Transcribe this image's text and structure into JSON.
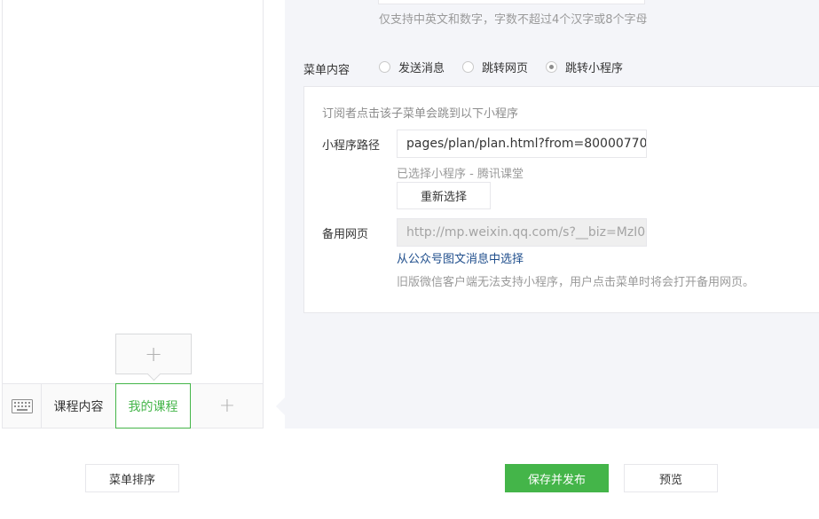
{
  "phone": {
    "menu_items": [
      "课程内容",
      "我的课程"
    ],
    "active_item_index": 1,
    "add_menu_symbol": "+",
    "add_submenu_symbol": "+",
    "keyboard_icon": "keyboard-icon"
  },
  "editor": {
    "name_tip": "仅支持中英文和数字，字数不超过4个汉字或8个字母",
    "content_label": "菜单内容",
    "radio_options": [
      {
        "label": "发送消息",
        "checked": false
      },
      {
        "label": "跳转网页",
        "checked": false
      },
      {
        "label": "跳转小程序",
        "checked": true
      }
    ],
    "miniprogram": {
      "tip": "订阅者点击该子菜单会跳到以下小程序",
      "path_label": "小程序路径",
      "path_value": "pages/plan/plan.html?from=80000770",
      "selected_tip": "已选择小程序 - 腾讯课堂",
      "reselect_label": "重新选择",
      "backup_label": "备用网页",
      "backup_value": "http://mp.weixin.qq.com/s?__biz=MzI0",
      "select_link": "从公众号图文消息中选择",
      "old_version_tip": "旧版微信客户端无法支持小程序，用户点击菜单时将会打开备用网页。"
    }
  },
  "footer": {
    "sort_label": "菜单排序",
    "save_label": "保存并发布",
    "preview_label": "预览"
  },
  "colors": {
    "accent": "#44b549",
    "link": "#1f4e8c",
    "panel_bg": "#f4f5f9"
  }
}
